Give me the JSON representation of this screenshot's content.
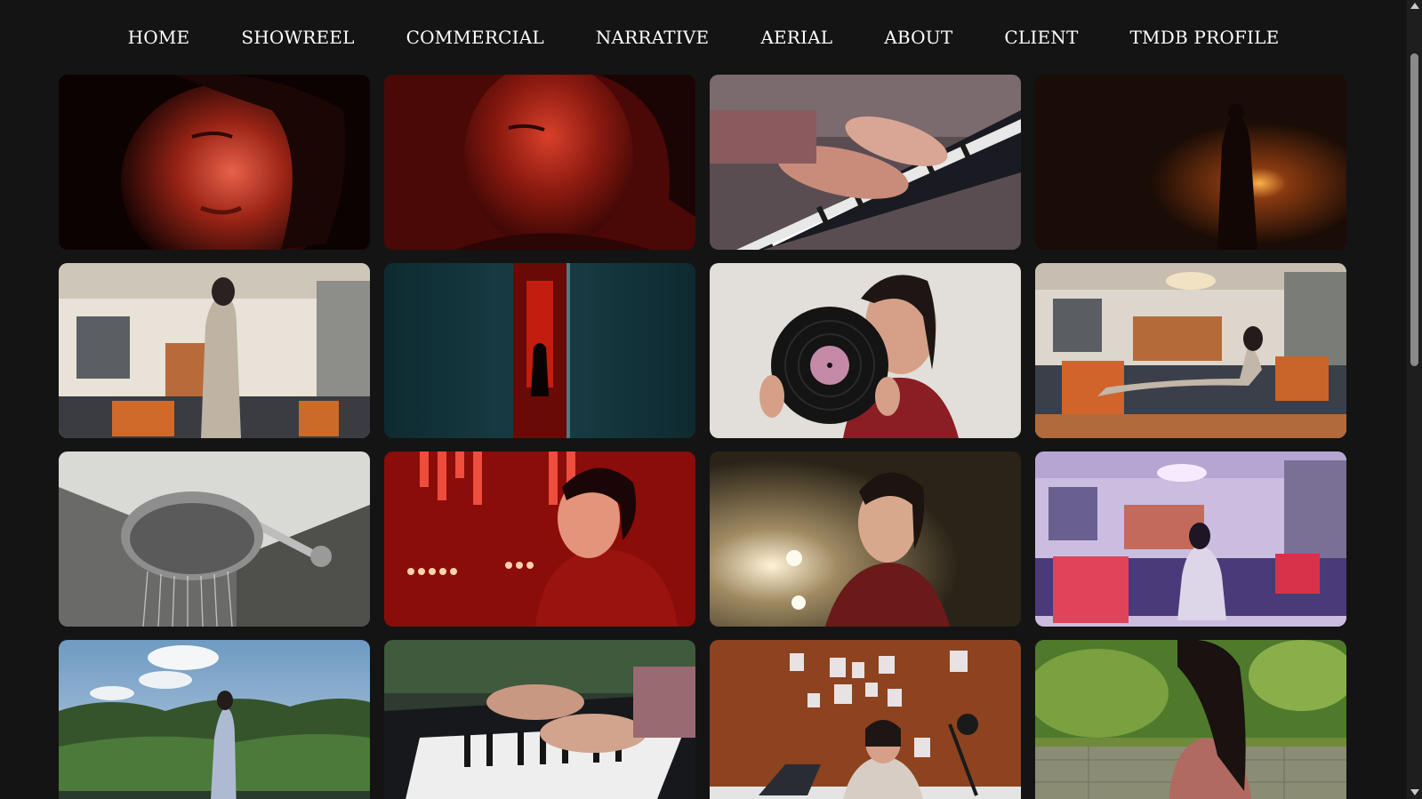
{
  "nav": {
    "items": [
      {
        "label": "HOME"
      },
      {
        "label": "SHOWREEL"
      },
      {
        "label": "COMMERCIAL"
      },
      {
        "label": "NARRATIVE"
      },
      {
        "label": "AERIAL"
      },
      {
        "label": "ABOUT"
      },
      {
        "label": "CLIENT"
      },
      {
        "label": "TMDB PROFILE"
      }
    ]
  },
  "theme": {
    "background": "#141414",
    "nav_text": "#ffffff",
    "scrollbar_track": "#1e1e1e",
    "scrollbar_thumb": "#8a8a8a"
  }
}
